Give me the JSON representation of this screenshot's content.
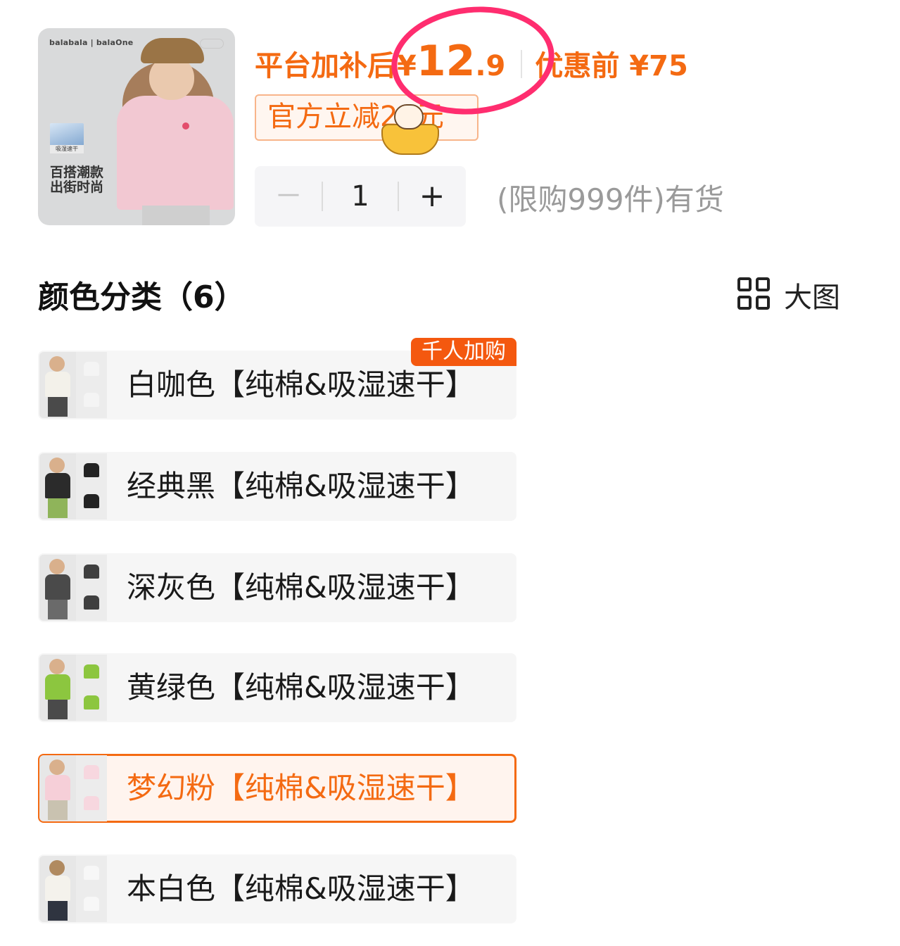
{
  "product": {
    "brand": "balabala | balaOne",
    "tech_label": "吸湿速干",
    "slogan_line1": "百搭潮款",
    "slogan_line2": "出街时尚"
  },
  "price": {
    "label": "平台加补后",
    "currency": "¥",
    "integer": "12",
    "decimal": ".9",
    "before_label": "优惠前 ¥75"
  },
  "coupon": {
    "text": "官方立减20元"
  },
  "quantity": {
    "minus": "－",
    "value": "1",
    "plus": "+"
  },
  "stock_text": "(限购999件)有货",
  "section": {
    "title": "颜色分类（6）",
    "view_label": "大图"
  },
  "hot_badge": "千人加购",
  "options": [
    {
      "label": "白咖色【纯棉&吸湿速干】",
      "shirt_color": "#f3f1ea",
      "tee_color": "#f4f4f4"
    },
    {
      "label": "经典黑【纯棉&吸湿速干】",
      "shirt_color": "#2b2b2b",
      "tee_color": "#232323"
    },
    {
      "label": "深灰色【纯棉&吸湿速干】",
      "shirt_color": "#4a4a4a",
      "tee_color": "#3f3f3f"
    },
    {
      "label": "黄绿色【纯棉&吸湿速干】",
      "shirt_color": "#8cc63f",
      "tee_color": "#8cc63f"
    },
    {
      "label": "梦幻粉【纯棉&吸湿速干】",
      "shirt_color": "#f6cfd8",
      "tee_color": "#f7d7df",
      "selected": true
    },
    {
      "label": "本白色【纯棉&吸湿速干】",
      "shirt_color": "#f4f2ec",
      "tee_color": "#f7f7f7"
    }
  ],
  "colors": {
    "accent": "#f46a12",
    "circle_mark": "#ff2d6f"
  }
}
